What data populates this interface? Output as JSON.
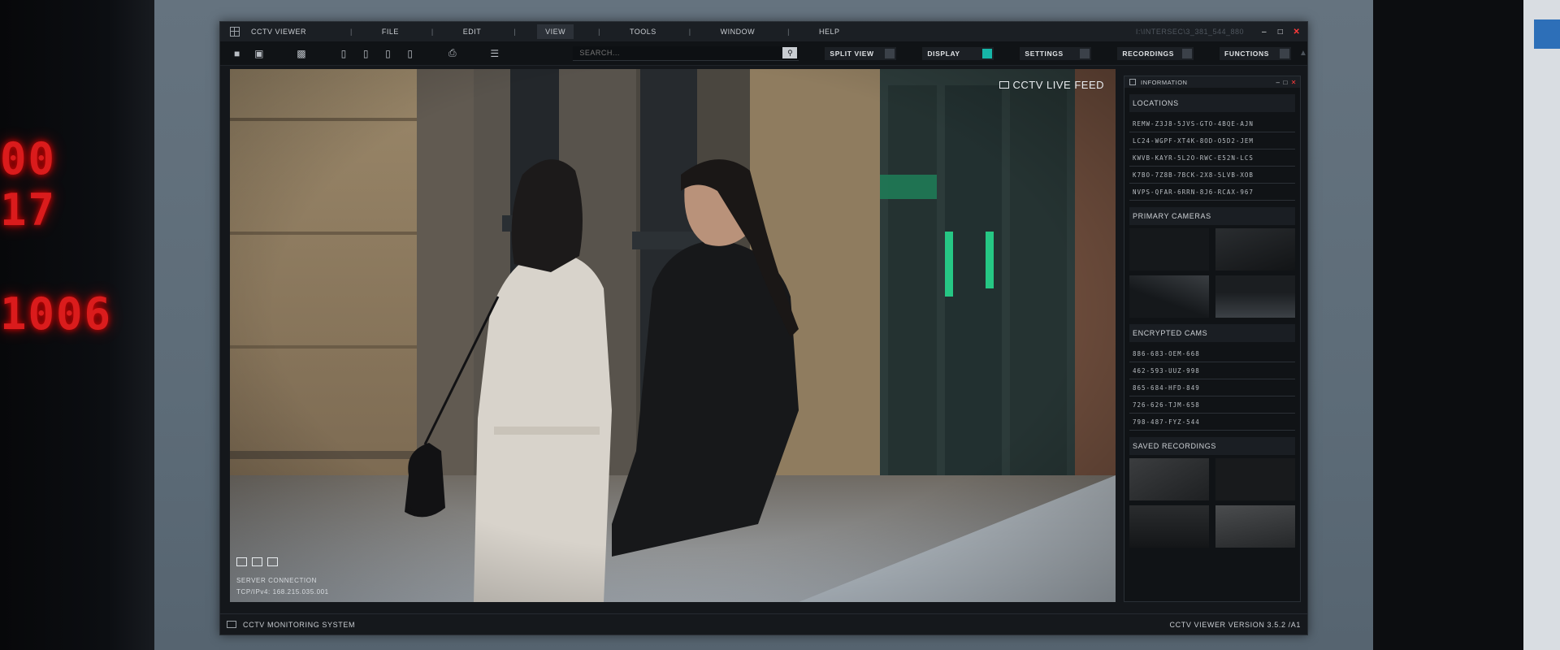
{
  "led_display": {
    "line1": "00 17",
    "line2": "1006"
  },
  "menubar": {
    "app_title": "CCTV VIEWER",
    "items": [
      "FILE",
      "EDIT",
      "VIEW",
      "TOOLS",
      "WINDOW",
      "HELP"
    ],
    "active_item": "VIEW",
    "window_path": "I:\\INTERSEC\\3_381_544_880"
  },
  "toolbar": {
    "search_placeholder": "SEARCH...",
    "view_buttons": [
      {
        "label": "SPLIT VIEW",
        "on": false
      },
      {
        "label": "DISPLAY",
        "on": true
      },
      {
        "label": "SETTINGS",
        "on": false
      },
      {
        "label": "RECORDINGS",
        "on": false
      },
      {
        "label": "FUNCTIONS",
        "on": false
      }
    ]
  },
  "video": {
    "live_feed_label": "CCTV LIVE FEED",
    "server_label": "SERVER CONNECTION",
    "server_ip": "TCP/IPv4: 168.215.035.001"
  },
  "info_panel": {
    "title": "INFORMATION",
    "locations_heading": "LOCATIONS",
    "locations": [
      "REMW-Z3J8-5JVS-GTO-4BQE-AJN",
      "LC24-WGPF-XT4K-8OD-O5D2-JEM",
      "KWVB-KAYR-5L2O-RWC-E52N-LCS",
      "K7BO-7Z8B-7BCK-2X8-5LVB-XOB",
      "NVPS-QFAR-6RRN-8J6-RCAX-967"
    ],
    "primary_heading": "PRIMARY CAMERAS",
    "encrypted_heading": "ENCRYPTED CAMS",
    "encrypted": [
      "886-683-OEM-668",
      "462-593-UUZ-998",
      "865-684-HFD-849",
      "726-626-TJM-658",
      "798-487-FYZ-544"
    ],
    "saved_heading": "SAVED RECORDINGS"
  },
  "statusbar": {
    "system_label": "CCTV MONITORING SYSTEM",
    "version": "CCTV VIEWER  VERSION 3.5.2 /A1"
  },
  "colors": {
    "accent": "#16b6a8",
    "close": "#ff3b3b",
    "led": "#ff1f1f"
  }
}
